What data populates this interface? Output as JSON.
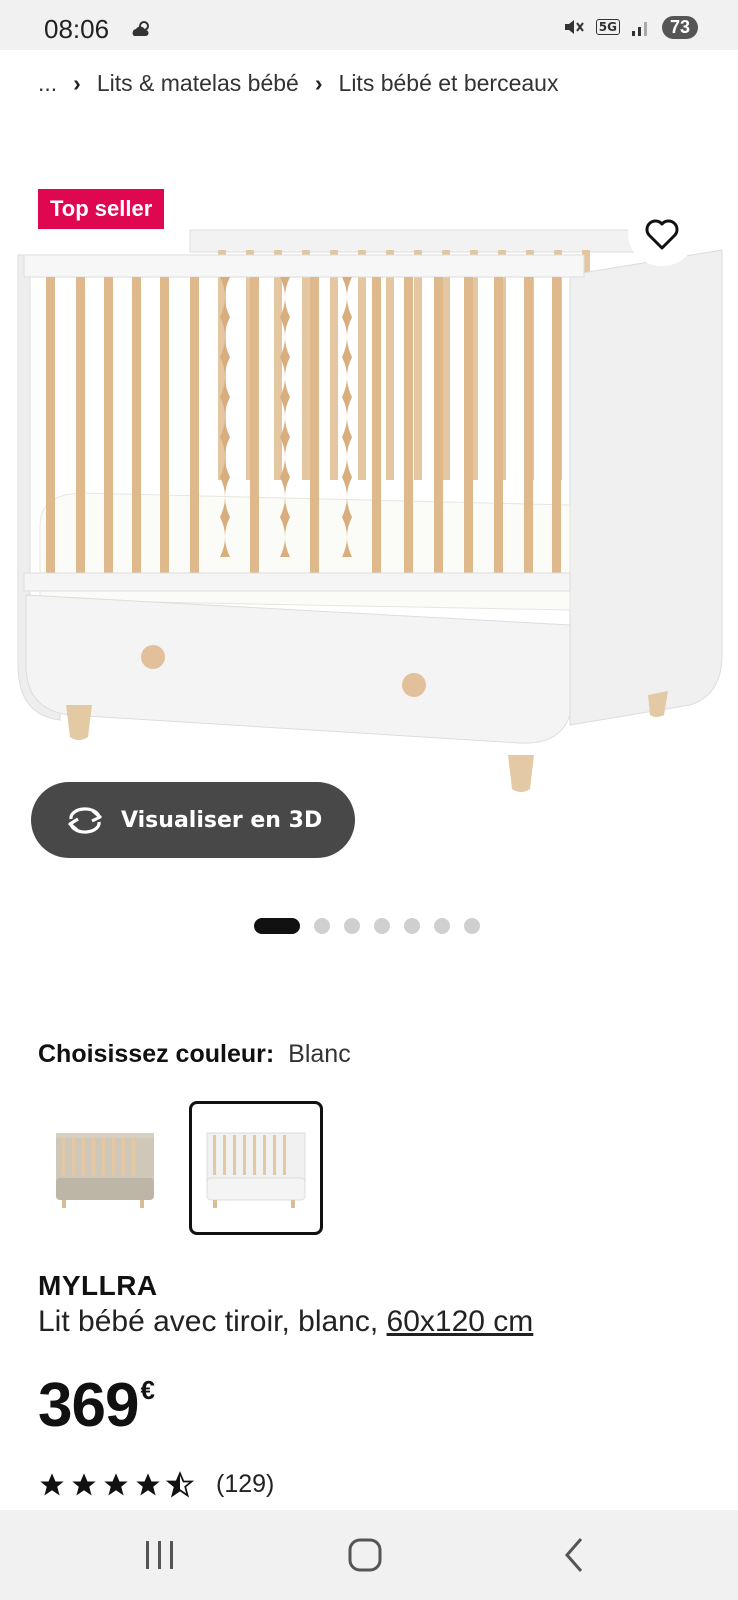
{
  "status_bar": {
    "time": "08:06",
    "network": "5G",
    "battery": "73",
    "icons": [
      "weather-cloud-icon",
      "mute-icon",
      "signal-icon"
    ]
  },
  "breadcrumb": {
    "ellipsis": "...",
    "items": [
      "Lits & matelas bébé",
      "Lits bébé et berceaux"
    ]
  },
  "badge": {
    "label": "Top seller",
    "color": "#e00751"
  },
  "favorite": {
    "icon": "heart-icon"
  },
  "viewer": {
    "label": "Visualiser en 3D",
    "icon": "rotate-3d-icon"
  },
  "carousel": {
    "total": 7,
    "active_index": 0
  },
  "color_chooser": {
    "label": "Choisissez couleur:",
    "value": "Blanc",
    "swatches": [
      {
        "color": "Beige",
        "selected": false
      },
      {
        "color": "Blanc",
        "selected": true
      }
    ]
  },
  "product": {
    "name": "MYLLRA",
    "description": "Lit bébé avec tiroir, blanc,",
    "size": "60x120 cm",
    "price_integer": "369",
    "currency": "€",
    "rating": 4.5,
    "rating_max": 5,
    "review_count": "(129)"
  },
  "navbar": {
    "buttons": [
      "recents-icon",
      "home-icon",
      "back-icon"
    ]
  }
}
